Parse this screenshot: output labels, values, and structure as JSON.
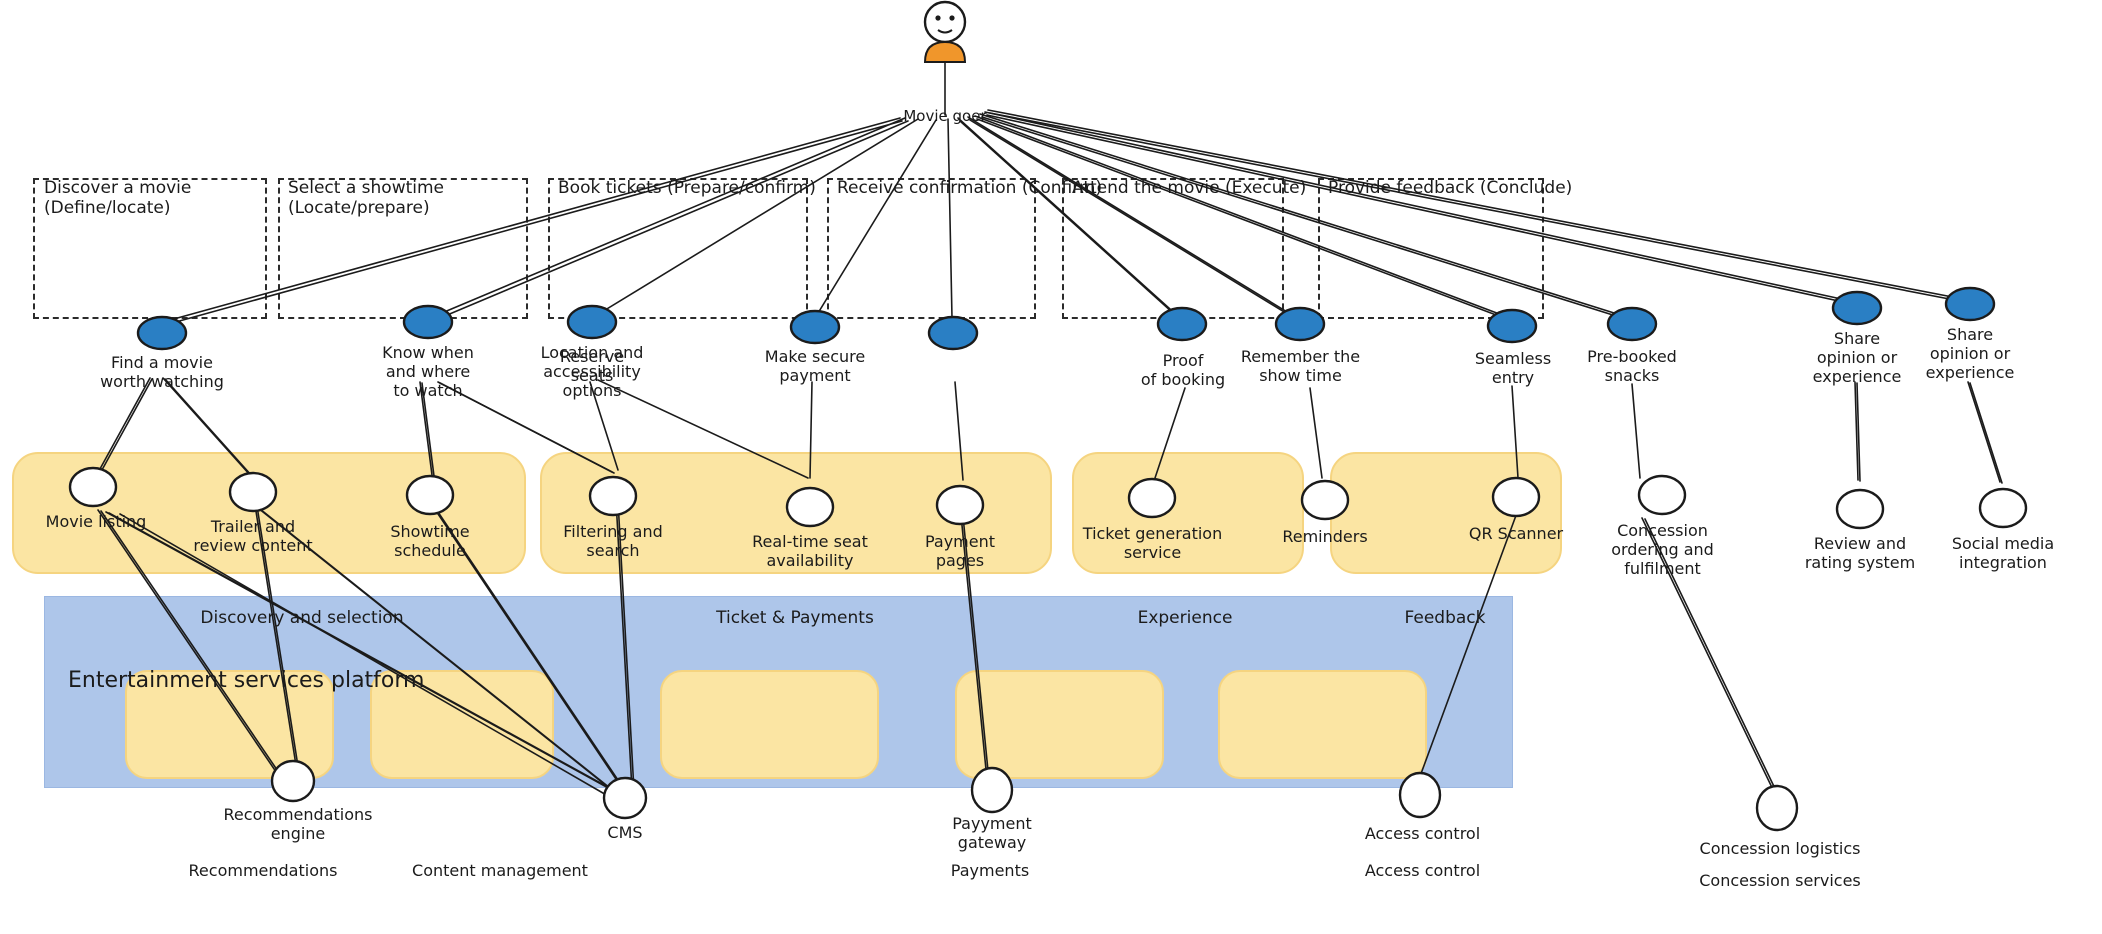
{
  "diagram": {
    "title_platform": "Entertainment services platform",
    "actor": {
      "name": "Movie goer",
      "icon": "stick-figure-actor-icon",
      "body_color": "#f0962b"
    },
    "colors": {
      "goal_node_fill": "#2a7fc4",
      "capability_node_fill": "#ffffff",
      "band_yellow": "#fbe5a3",
      "band_yellow_border": "#f5d480",
      "band_blue": "#aec6ea",
      "stroke": "#1b1b1b"
    }
  },
  "stages": [
    {
      "title": "Discover a movie (Define/locate)",
      "goals": [
        {
          "label": "Find a movie\nworth watching"
        }
      ]
    },
    {
      "title": "Select a showtime (Locate/prepare)",
      "goals": [
        {
          "label": "Know when\nand where\nto watch"
        },
        {
          "label": "Location and\naccessibility\noptions"
        }
      ]
    },
    {
      "title": "Book tickets (Prepare/confirm)",
      "goals": [
        {
          "label": "Reserve\nseats"
        },
        {
          "label": "Make secure\npayment"
        }
      ]
    },
    {
      "title": "Receive confirmation (Confirm)",
      "goals": [
        {
          "label": "Proof\nof booking"
        },
        {
          "label": "Remember the\nshow time"
        }
      ]
    },
    {
      "title": "Attend the movie (Execute)",
      "goals": [
        {
          "label": "Seamless\nentry"
        },
        {
          "label": "Pre-booked\nsnacks"
        }
      ]
    },
    {
      "title": "Provide feedback (Conclude)",
      "goals": [
        {
          "label": "Share\nopinion or\nexperience"
        },
        {
          "label": "Share\nopinion or\nexperience"
        }
      ]
    }
  ],
  "capability_bands": [
    {
      "name": "Discovery and selection",
      "capabilities": [
        {
          "label": "Movie listing"
        },
        {
          "label": "Trailer and\nreview content"
        },
        {
          "label": "Showtime schedule"
        },
        {
          "label": "Filtering and\nsearch"
        }
      ]
    },
    {
      "name": "Ticket & Payments",
      "capabilities": [
        {
          "label": "Real-time seat\navailability"
        },
        {
          "label": "Payment\npages"
        },
        {
          "label": "Ticket generation\nservice"
        },
        {
          "label": "Reminders"
        }
      ]
    },
    {
      "name": "Experience",
      "capabilities": [
        {
          "label": "QR Scanner"
        },
        {
          "label": "Concession\nordering and\nfulfilment"
        }
      ]
    },
    {
      "name": "Feedback",
      "capabilities": [
        {
          "label": "Review and\nrating system"
        },
        {
          "label": "Social media\nintegration"
        }
      ]
    }
  ],
  "platform_services": [
    {
      "node": "Recommendations\nengine",
      "group": "Recommendations"
    },
    {
      "node": "CMS",
      "group": "Content management"
    },
    {
      "node": "Payyment\ngateway",
      "group": "Payments"
    },
    {
      "node": "Access control",
      "group": "Access control"
    },
    {
      "node": "Concession logistics",
      "group": "Concession services"
    }
  ]
}
